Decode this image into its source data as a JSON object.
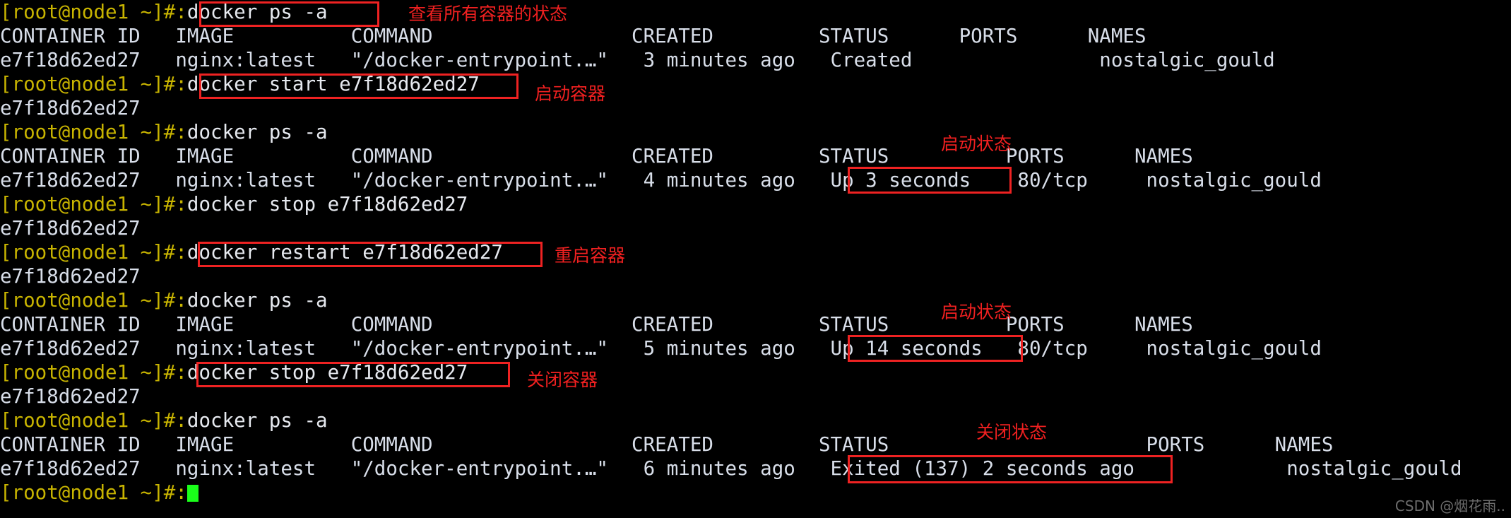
{
  "terminal": {
    "prompt": "[root@node1 ~]#:",
    "cursor_glyph": "",
    "colors": {
      "background": "#000000",
      "foreground": "#d8dee9",
      "prompt": "#c8b400",
      "annotation_red": "#f02020",
      "box_red": "#ee2222",
      "cursor_green": "#1aff1a",
      "watermark_gray": "#6d6d6d"
    },
    "lines": [
      {
        "id": "l1",
        "type": "command",
        "command": "docker ps -a"
      },
      {
        "id": "l2",
        "type": "output",
        "text": "CONTAINER ID   IMAGE          COMMAND                 CREATED         STATUS      PORTS      NAMES"
      },
      {
        "id": "l3",
        "type": "output",
        "text": "e7f18d62ed27   nginx:latest   \"/docker-entrypoint.…\"   3 minutes ago   Created                nostalgic_gould"
      },
      {
        "id": "l4",
        "type": "command",
        "command": "docker start e7f18d62ed27"
      },
      {
        "id": "l5",
        "type": "output",
        "text": "e7f18d62ed27"
      },
      {
        "id": "l6",
        "type": "command",
        "command": "docker ps -a"
      },
      {
        "id": "l7",
        "type": "output",
        "text": "CONTAINER ID   IMAGE          COMMAND                 CREATED         STATUS          PORTS      NAMES"
      },
      {
        "id": "l8",
        "type": "output",
        "text": "e7f18d62ed27   nginx:latest   \"/docker-entrypoint.…\"   4 minutes ago   Up 3 seconds    80/tcp     nostalgic_gould"
      },
      {
        "id": "l9",
        "type": "command",
        "command": "docker stop e7f18d62ed27"
      },
      {
        "id": "l10",
        "type": "output",
        "text": "e7f18d62ed27"
      },
      {
        "id": "l11",
        "type": "command",
        "command": "docker restart e7f18d62ed27"
      },
      {
        "id": "l12",
        "type": "output",
        "text": "e7f18d62ed27"
      },
      {
        "id": "l13",
        "type": "command",
        "command": "docker ps -a"
      },
      {
        "id": "l14",
        "type": "output",
        "text": "CONTAINER ID   IMAGE          COMMAND                 CREATED         STATUS          PORTS      NAMES"
      },
      {
        "id": "l15",
        "type": "output",
        "text": "e7f18d62ed27   nginx:latest   \"/docker-entrypoint.…\"   5 minutes ago   Up 14 seconds   80/tcp     nostalgic_gould"
      },
      {
        "id": "l16",
        "type": "command",
        "command": "docker stop e7f18d62ed27"
      },
      {
        "id": "l17",
        "type": "output",
        "text": "e7f18d62ed27"
      },
      {
        "id": "l18",
        "type": "command",
        "command": "docker ps -a"
      },
      {
        "id": "l19",
        "type": "output",
        "text": "CONTAINER ID   IMAGE          COMMAND                 CREATED         STATUS                      PORTS      NAMES"
      },
      {
        "id": "l20",
        "type": "output",
        "text": "e7f18d62ed27   nginx:latest   \"/docker-entrypoint.…\"   6 minutes ago   Exited (137) 2 seconds ago             nostalgic_gould"
      },
      {
        "id": "l21",
        "type": "prompt_only",
        "command": ""
      }
    ],
    "table_headers": [
      "CONTAINER ID",
      "IMAGE",
      "COMMAND",
      "CREATED",
      "STATUS",
      "PORTS",
      "NAMES"
    ],
    "container": {
      "id": "e7f18d62ed27",
      "image": "nginx:latest",
      "command": "\"/docker-entrypoint.…\"",
      "name": "nostalgic_gould",
      "port": "80/tcp"
    },
    "statuses": {
      "created": "Created",
      "up_3": "Up 3 seconds",
      "up_14": "Up 14 seconds",
      "exited": "Exited (137) 2 seconds ago"
    },
    "created_times": [
      "3 minutes ago",
      "4 minutes ago",
      "5 minutes ago",
      "6 minutes ago"
    ]
  },
  "annotations": [
    {
      "id": "a1",
      "text": "查看所有容器的状态"
    },
    {
      "id": "a2",
      "text": "启动容器"
    },
    {
      "id": "a3",
      "text": "启动状态"
    },
    {
      "id": "a4",
      "text": "重启容器"
    },
    {
      "id": "a5",
      "text": "启动状态"
    },
    {
      "id": "a6",
      "text": "关闭容器"
    },
    {
      "id": "a7",
      "text": "关闭状态"
    }
  ],
  "watermark": {
    "text": "CSDN @烟花雨.."
  }
}
